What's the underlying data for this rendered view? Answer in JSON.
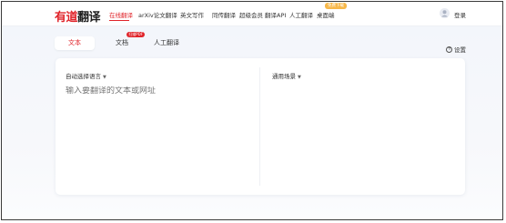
{
  "brand": {
    "logo_part1": "有道",
    "logo_part2": "翻译"
  },
  "nav": {
    "items": [
      "在线翻译",
      "arXiv论文翻译",
      "英文写作",
      "同传翻译",
      "超级会员",
      "翻译API",
      "人工翻译",
      "桌面端"
    ],
    "active_index": 0,
    "desktop_badge": "免费下载"
  },
  "user": {
    "login_label": "登录"
  },
  "tabs": [
    {
      "label": "文本"
    },
    {
      "label": "文档",
      "badge": "扫描PDF"
    },
    {
      "label": "人工翻译"
    }
  ],
  "settings_label": "设置",
  "editor": {
    "source_lang": "自动选择语言",
    "target_lang": "通用场景",
    "placeholder": "输入要翻译的文本或网址"
  },
  "colors": {
    "accent": "#e0242a",
    "badge_orange": "#f7b84a"
  }
}
